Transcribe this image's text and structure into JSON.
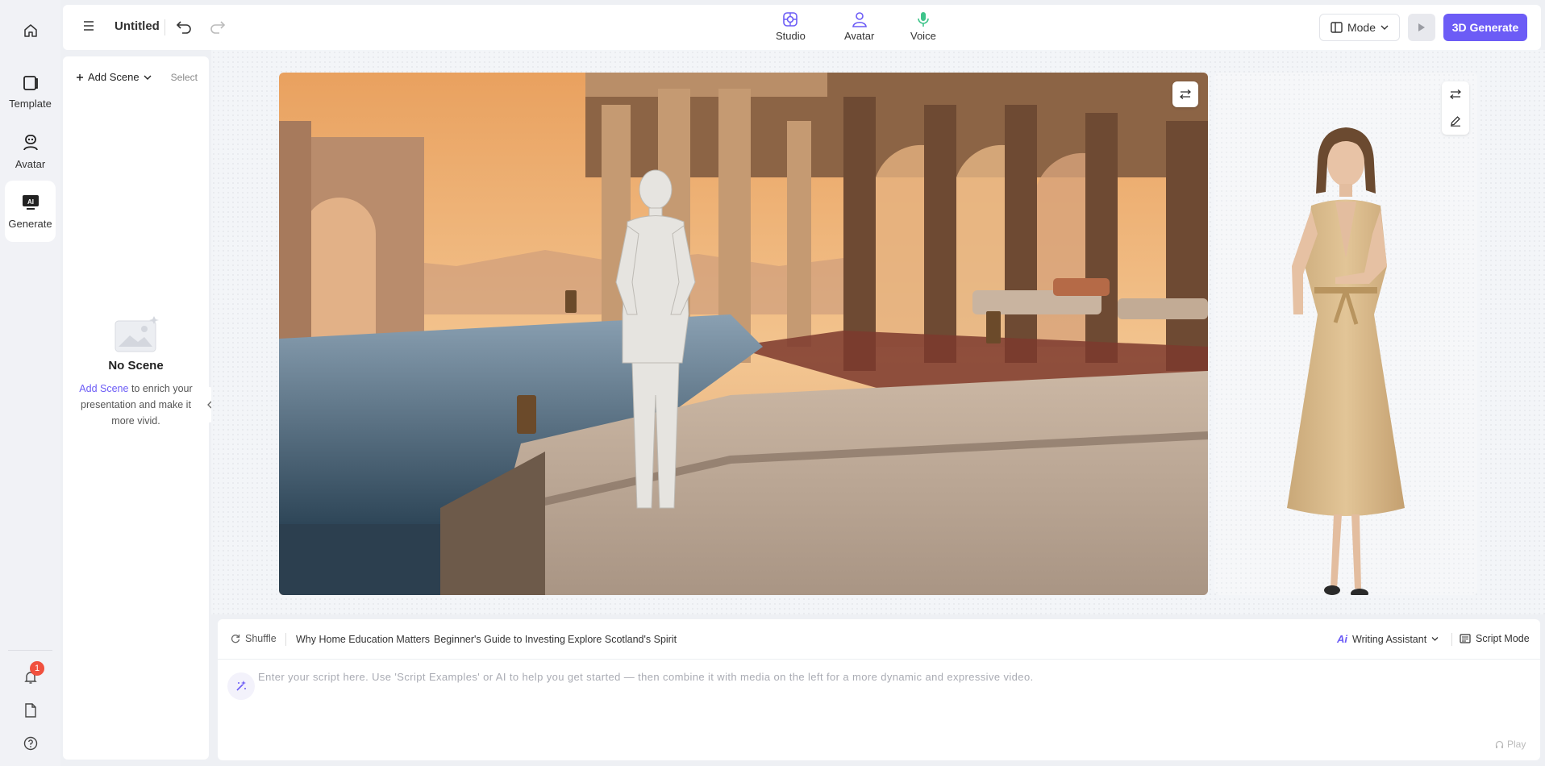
{
  "rail": {
    "items": [
      {
        "label": "Template",
        "icon": "template-icon"
      },
      {
        "label": "Avatar",
        "icon": "avatar-icon"
      },
      {
        "label": "Generate",
        "icon": "ai-generate-icon"
      }
    ],
    "notification_count": "1"
  },
  "topbar": {
    "title": "Untitled",
    "tabs": [
      {
        "label": "Studio",
        "icon": "studio-icon"
      },
      {
        "label": "Avatar",
        "icon": "avatar-icon"
      },
      {
        "label": "Voice",
        "icon": "microphone-icon"
      }
    ],
    "mode_label": "Mode",
    "generate_label": "3D Generate"
  },
  "scene_panel": {
    "add_scene_label": "Add Scene",
    "select_label": "Select",
    "empty_title": "No Scene",
    "empty_link": "Add Scene",
    "empty_text": " to enrich your presentation and make it more vivid."
  },
  "script": {
    "shuffle_label": "Shuffle",
    "topics": [
      "Why Home Education Matters",
      "Beginner's Guide to Investing",
      "Explore Scotland's Spirit"
    ],
    "ai_mark": "Ai",
    "writing_assistant_label": "Writing Assistant",
    "script_mode_label": "Script Mode",
    "placeholder": "Enter your script here. Use 'Script Examples' or AI to help you get started — then combine it with media on the left for a more dynamic and expressive video.",
    "play_label": "Play"
  },
  "colors": {
    "accent": "#6c5cf6",
    "badge": "#f0503e"
  }
}
